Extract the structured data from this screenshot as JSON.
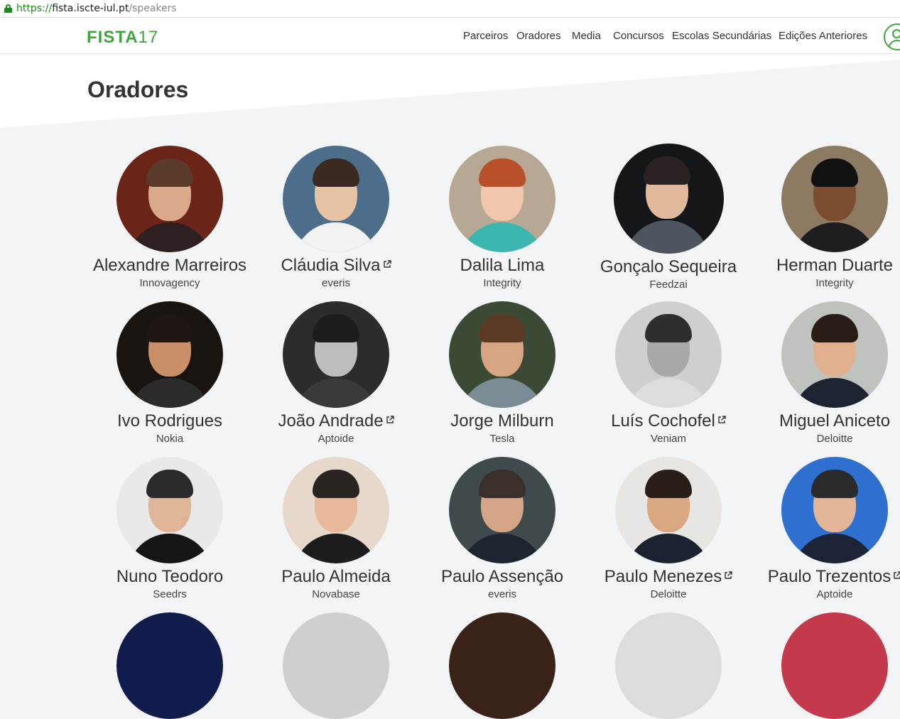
{
  "browser": {
    "url_scheme": "https://",
    "url_host": "fista.iscte-iul.pt",
    "url_path": "/speakers"
  },
  "header": {
    "logo_text": "FISTA",
    "logo_number": "17",
    "nav": [
      "Parceiros",
      "Oradores",
      "Media",
      "Concursos",
      "Escolas Secundárias",
      "Edições Anteriores"
    ]
  },
  "page": {
    "title": "Oradores"
  },
  "colors": {
    "brand": "#3da63d",
    "background": "#f3f4f6",
    "text": "#333333"
  },
  "speakers": [
    {
      "name": "Alexandre Marreiros",
      "company": "Innovagency",
      "external": false
    },
    {
      "name": "Cláudia Silva",
      "company": "everis",
      "external": true
    },
    {
      "name": "Dalila Lima",
      "company": "Integrity",
      "external": false
    },
    {
      "name": "Gonçalo Sequeira",
      "company": "Feedzai",
      "external": false
    },
    {
      "name": "Herman Duarte",
      "company": "Integrity",
      "external": false
    },
    {
      "name": "Ivo Rodrigues",
      "company": "Nokia",
      "external": false
    },
    {
      "name": "João Andrade",
      "company": "Aptoide",
      "external": true
    },
    {
      "name": "Jorge Milburn",
      "company": "Tesla",
      "external": false
    },
    {
      "name": "Luís Cochofel",
      "company": "Veniam",
      "external": true
    },
    {
      "name": "Miguel Aniceto",
      "company": "Deloitte",
      "external": false
    },
    {
      "name": "Nuno Teodoro",
      "company": "Seedrs",
      "external": false
    },
    {
      "name": "Paulo Almeida",
      "company": "Novabase",
      "external": false
    },
    {
      "name": "Paulo Assenção",
      "company": "everis",
      "external": false
    },
    {
      "name": "Paulo Menezes",
      "company": "Deloitte",
      "external": true
    },
    {
      "name": "Paulo Trezentos",
      "company": "Aptoide",
      "external": true
    }
  ],
  "icons": {
    "secure": "lock-icon",
    "external": "external-link-icon",
    "user": "user-icon"
  }
}
